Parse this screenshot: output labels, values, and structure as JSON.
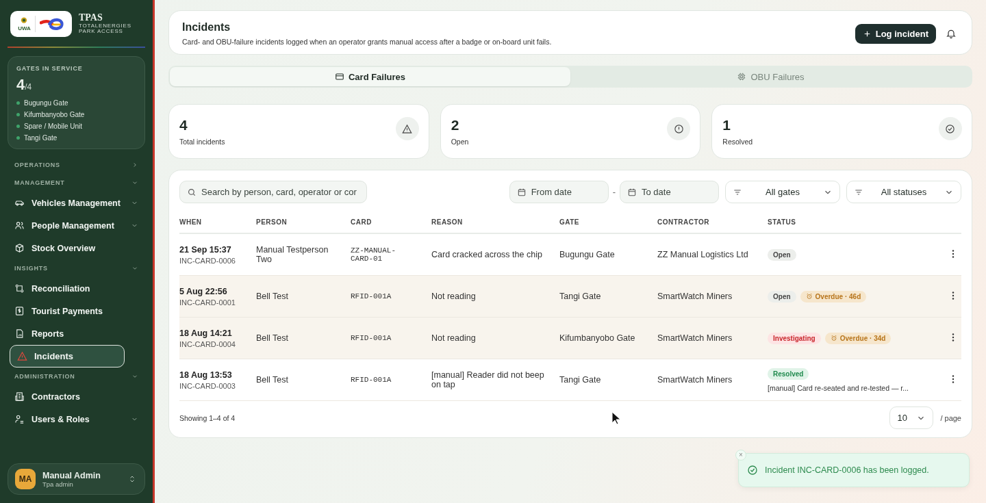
{
  "brand": {
    "name": "TPAS",
    "subtitle_1": "TOTALENERGIES",
    "subtitle_2": "PARK ACCESS",
    "logo_text": "UWA"
  },
  "gates": {
    "title": "GATES IN SERVICE",
    "count": "4",
    "total": "/4",
    "items": [
      {
        "name": "Bugungu Gate",
        "color": "#3fa36b"
      },
      {
        "name": "Kifumbanyobo Gate",
        "color": "#3fa36b"
      },
      {
        "name": "Spare / Mobile Unit",
        "color": "#3fa36b"
      },
      {
        "name": "Tangi Gate",
        "color": "#3fa36b"
      }
    ]
  },
  "sidebar": {
    "sections": [
      {
        "label": "OPERATIONS",
        "expanded": false
      },
      {
        "label": "MANAGEMENT",
        "expanded": true,
        "items": [
          {
            "label": "Vehicles Management",
            "kind": "car",
            "has_submenu": true,
            "selected": false
          },
          {
            "label": "People Management",
            "kind": "people",
            "has_submenu": true,
            "selected": false
          },
          {
            "label": "Stock Overview",
            "kind": "box",
            "has_submenu": false,
            "selected": false
          }
        ]
      },
      {
        "label": "INSIGHTS",
        "expanded": true,
        "items": [
          {
            "label": "Reconciliation",
            "kind": "reconcile",
            "has_submenu": false,
            "selected": false
          },
          {
            "label": "Tourist Payments",
            "kind": "payment",
            "has_submenu": false,
            "selected": false
          },
          {
            "label": "Reports",
            "kind": "report",
            "has_submenu": false,
            "selected": false
          },
          {
            "label": "Incidents",
            "kind": "warning",
            "has_submenu": false,
            "selected": true
          }
        ]
      },
      {
        "label": "ADMINISTRATION",
        "expanded": true,
        "items": [
          {
            "label": "Contractors",
            "kind": "building",
            "has_submenu": false,
            "selected": false
          },
          {
            "label": "Users & Roles",
            "kind": "users",
            "has_submenu": true,
            "selected": false
          }
        ]
      }
    ]
  },
  "user": {
    "initials": "MA",
    "name": "Manual Admin",
    "role": "Tpa admin"
  },
  "header": {
    "title": "Incidents",
    "description": "Card- and OBU-failure incidents logged when an operator grants manual access after a badge or on-board unit fails.",
    "action": "Log incident"
  },
  "tabs": [
    {
      "label": "Card Failures",
      "kind": "card",
      "selected": true
    },
    {
      "label": "OBU Failures",
      "kind": "chip",
      "selected": false
    }
  ],
  "stats": [
    {
      "value": "4",
      "label": "Total incidents",
      "kind": "warning"
    },
    {
      "value": "2",
      "label": "Open",
      "kind": "info"
    },
    {
      "value": "1",
      "label": "Resolved",
      "kind": "check"
    }
  ],
  "filters": {
    "search_placeholder": "Search by person, card, operator or cor",
    "from_placeholder": "From date",
    "separator": "-",
    "to_placeholder": "To date",
    "gates": "All gates",
    "statuses": "All statuses"
  },
  "table": {
    "columns": [
      "WHEN",
      "PERSON",
      "CARD",
      "REASON",
      "GATE",
      "CONTRACTOR",
      "STATUS"
    ],
    "rows": [
      {
        "when": "21 Sep 15:37",
        "id": "INC-CARD-0006",
        "person": "Manual Testperson Two",
        "card": "ZZ-MANUAL-CARD-01",
        "reason": "Card cracked across the chip",
        "gate": "Bugungu Gate",
        "contractor": "ZZ Manual Logistics Ltd",
        "status": {
          "label": "Open",
          "kind": "open"
        },
        "overdue": null,
        "note": null
      },
      {
        "when": "5 Aug 22:56",
        "id": "INC-CARD-0001",
        "person": "Bell Test",
        "card": "RFID-001A",
        "reason": "Not reading",
        "gate": "Tangi Gate",
        "contractor": "SmartWatch Miners",
        "status": {
          "label": "Open",
          "kind": "open"
        },
        "overdue": "Overdue · 46d",
        "note": null
      },
      {
        "when": "18 Aug 14:21",
        "id": "INC-CARD-0004",
        "person": "Bell Test",
        "card": "RFID-001A",
        "reason": "Not reading",
        "gate": "Kifumbanyobo Gate",
        "contractor": "SmartWatch Miners",
        "status": {
          "label": "Investigating",
          "kind": "investigating"
        },
        "overdue": "Overdue · 34d",
        "note": null
      },
      {
        "when": "18 Aug 13:53",
        "id": "INC-CARD-0003",
        "person": "Bell Test",
        "card": "RFID-001A",
        "reason": "[manual] Reader did not beep on tap",
        "gate": "Tangi Gate",
        "contractor": "SmartWatch Miners",
        "status": {
          "label": "Resolved",
          "kind": "resolved"
        },
        "overdue": null,
        "note": "[manual] Card re-seated and re-tested — r..."
      }
    ]
  },
  "pagination": {
    "summary": "Showing 1–4 of 4",
    "page_size": "10",
    "per_page": "/ page"
  },
  "toast": {
    "message": "Incident INC-CARD-0006 has been logged.",
    "close": "×"
  }
}
